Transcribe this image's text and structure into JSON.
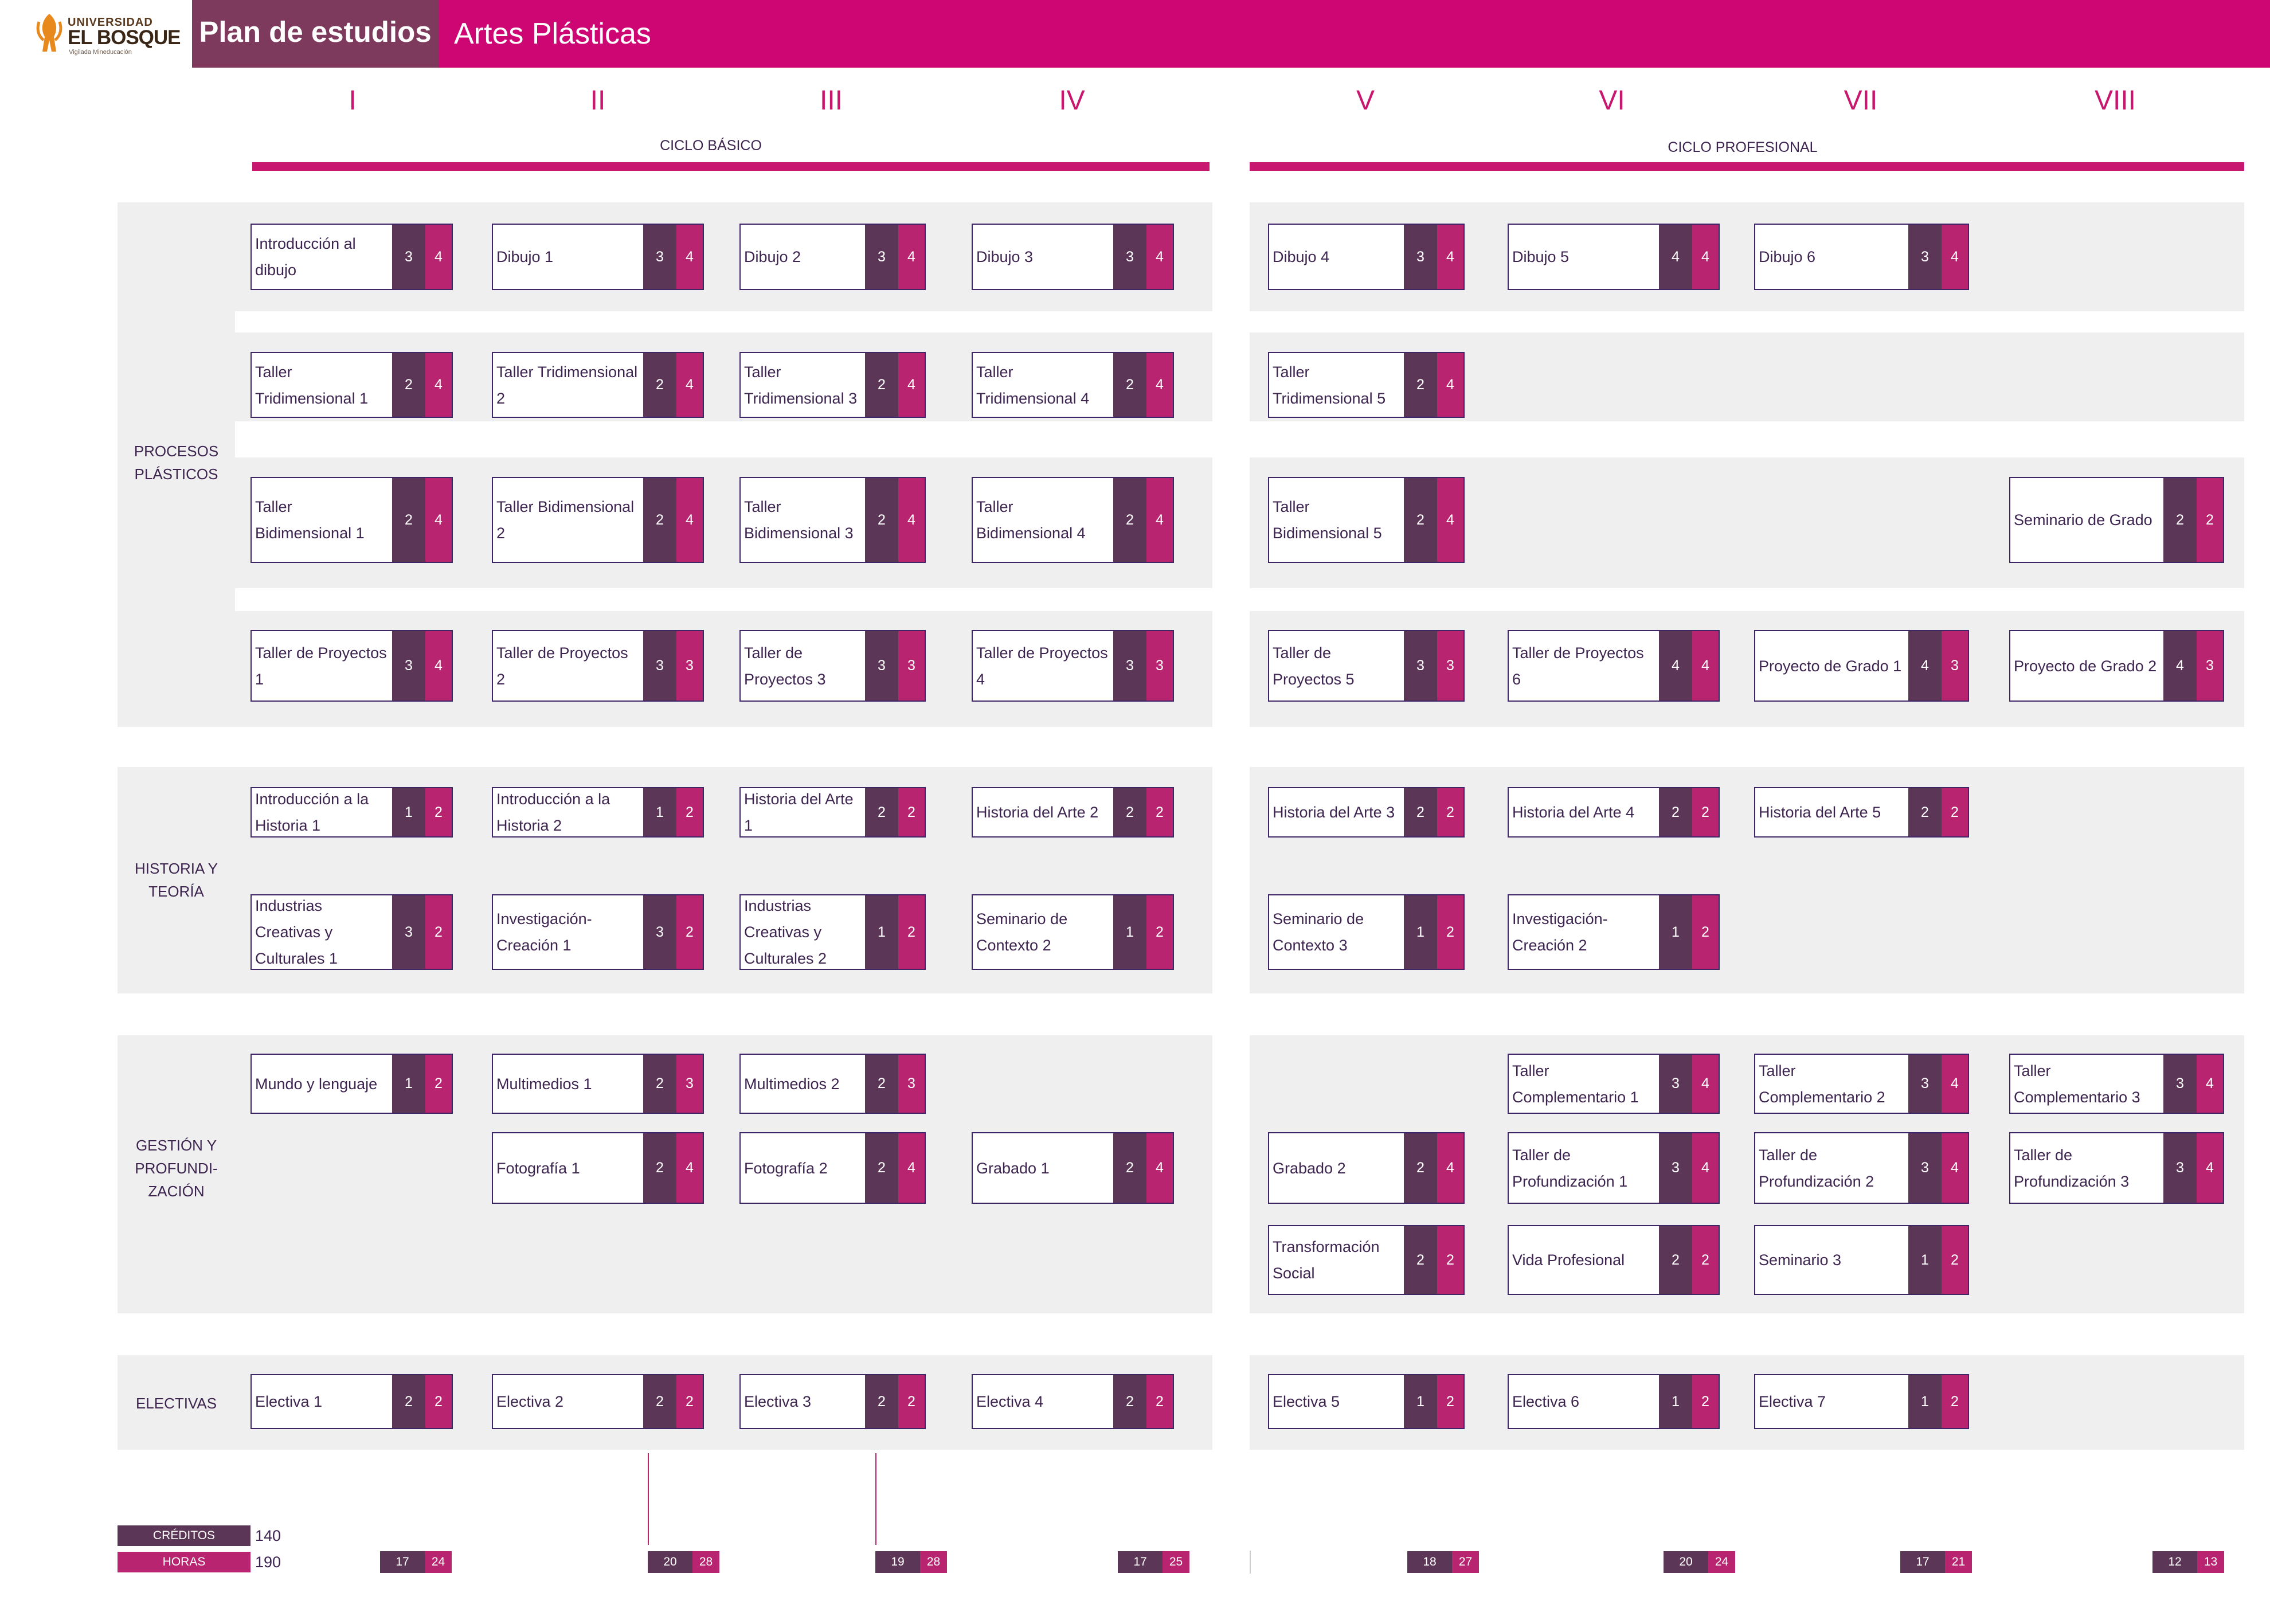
{
  "header": {
    "logo_univ": "UNIVERSIDAD",
    "logo_name": "EL BOSQUE",
    "logo_motto": "Vigilada Mineducación",
    "title": "Plan de estudios",
    "subtitle": "Artes Plásticas"
  },
  "semesters": [
    "I",
    "II",
    "III",
    "IV",
    "V",
    "VI",
    "VII",
    "VIII"
  ],
  "cycles": {
    "basic": "CICLO BÁSICO",
    "professional": "CICLO PROFESIONAL"
  },
  "areas": {
    "procesos": "PROCESOS PLÁSTICOS",
    "historia": "HISTORIA Y TEORÍA",
    "gestion": "GESTIÓN Y PROFUNDI-ZACIÓN",
    "electivas": "ELECTIVAS"
  },
  "courses": [
    {
      "name": "Introducción al dibujo",
      "credits": "3",
      "hours": "4"
    },
    {
      "name": "Dibujo 1",
      "credits": "3",
      "hours": "4"
    },
    {
      "name": "Dibujo 2",
      "credits": "3",
      "hours": "4"
    },
    {
      "name": "Dibujo 3",
      "credits": "3",
      "hours": "4"
    },
    {
      "name": "Dibujo 4",
      "credits": "3",
      "hours": "4"
    },
    {
      "name": "Dibujo 5",
      "credits": "4",
      "hours": "4"
    },
    {
      "name": "Dibujo 6",
      "credits": "3",
      "hours": "4"
    },
    {
      "name": "Taller Tridimensional 1",
      "credits": "2",
      "hours": "4"
    },
    {
      "name": "Taller Tridimensional 2",
      "credits": "2",
      "hours": "4"
    },
    {
      "name": "Taller Tridimensional 3",
      "credits": "2",
      "hours": "4"
    },
    {
      "name": "Taller Tridimensional 4",
      "credits": "2",
      "hours": "4"
    },
    {
      "name": "Taller Tridimensional 5",
      "credits": "2",
      "hours": "4"
    },
    {
      "name": "Taller Bidimensional 1",
      "credits": "2",
      "hours": "4"
    },
    {
      "name": "Taller Bidimensional 2",
      "credits": "2",
      "hours": "4"
    },
    {
      "name": "Taller Bidimensional 3",
      "credits": "2",
      "hours": "4"
    },
    {
      "name": "Taller Bidimensional 4",
      "credits": "2",
      "hours": "4"
    },
    {
      "name": "Taller Bidimensional 5",
      "credits": "2",
      "hours": "4"
    },
    {
      "name": "Seminario de Grado",
      "credits": "2",
      "hours": "2"
    },
    {
      "name": "Taller de Proyectos 1",
      "credits": "3",
      "hours": "4"
    },
    {
      "name": "Taller de Proyectos 2",
      "credits": "3",
      "hours": "3"
    },
    {
      "name": "Taller de Proyectos 3",
      "credits": "3",
      "hours": "3"
    },
    {
      "name": "Taller de Proyectos 4",
      "credits": "3",
      "hours": "3"
    },
    {
      "name": "Taller de Proyectos 5",
      "credits": "3",
      "hours": "3"
    },
    {
      "name": "Taller de Proyectos 6",
      "credits": "4",
      "hours": "4"
    },
    {
      "name": "Proyecto de Grado 1",
      "credits": "4",
      "hours": "3"
    },
    {
      "name": "Proyecto de Grado 2",
      "credits": "4",
      "hours": "3"
    },
    {
      "name": "Introducción a la Historia 1",
      "credits": "1",
      "hours": "2"
    },
    {
      "name": "Introducción a la Historia 2",
      "credits": "1",
      "hours": "2"
    },
    {
      "name": "Historia del Arte 1",
      "credits": "2",
      "hours": "2"
    },
    {
      "name": "Historia del Arte 2",
      "credits": "2",
      "hours": "2"
    },
    {
      "name": "Historia del Arte 3",
      "credits": "2",
      "hours": "2"
    },
    {
      "name": "Historia del Arte 4",
      "credits": "2",
      "hours": "2"
    },
    {
      "name": "Historia del Arte 5",
      "credits": "2",
      "hours": "2"
    },
    {
      "name": "Industrias Creativas y Culturales 1",
      "credits": "3",
      "hours": "2"
    },
    {
      "name": "Investigación-Creación 1",
      "credits": "3",
      "hours": "2"
    },
    {
      "name": "Industrias Creativas y Culturales 2",
      "credits": "1",
      "hours": "2"
    },
    {
      "name": "Seminario de Contexto 2",
      "credits": "1",
      "hours": "2"
    },
    {
      "name": "Seminario de Contexto 3",
      "credits": "1",
      "hours": "2"
    },
    {
      "name": "Investigación-Creación 2",
      "credits": "1",
      "hours": "2"
    },
    {
      "name": "Mundo y lenguaje",
      "credits": "1",
      "hours": "2"
    },
    {
      "name": "Multimedios 1",
      "credits": "2",
      "hours": "3"
    },
    {
      "name": "Multimedios 2",
      "credits": "2",
      "hours": "3"
    },
    {
      "name": "Taller Complementario 1",
      "credits": "3",
      "hours": "4"
    },
    {
      "name": "Taller Complementario 2",
      "credits": "3",
      "hours": "4"
    },
    {
      "name": "Taller Complementario 3",
      "credits": "3",
      "hours": "4"
    },
    {
      "name": "Fotografía 1",
      "credits": "2",
      "hours": "4"
    },
    {
      "name": "Fotografía 2",
      "credits": "2",
      "hours": "4"
    },
    {
      "name": "Grabado 1",
      "credits": "2",
      "hours": "4"
    },
    {
      "name": "Grabado 2",
      "credits": "2",
      "hours": "4"
    },
    {
      "name": "Taller de Profundización 1",
      "credits": "3",
      "hours": "4"
    },
    {
      "name": "Taller de Profundización 2",
      "credits": "3",
      "hours": "4"
    },
    {
      "name": "Taller de Profundización 3",
      "credits": "3",
      "hours": "4"
    },
    {
      "name": "Transformación Social",
      "credits": "2",
      "hours": "2"
    },
    {
      "name": "Vida Profesional",
      "credits": "2",
      "hours": "2"
    },
    {
      "name": "Seminario 3",
      "credits": "1",
      "hours": "2"
    },
    {
      "name": "Electiva 1",
      "credits": "2",
      "hours": "2"
    },
    {
      "name": "Electiva 2",
      "credits": "2",
      "hours": "2"
    },
    {
      "name": "Electiva 3",
      "credits": "2",
      "hours": "2"
    },
    {
      "name": "Electiva 4",
      "credits": "2",
      "hours": "2"
    },
    {
      "name": "Electiva 5",
      "credits": "1",
      "hours": "2"
    },
    {
      "name": "Electiva 6",
      "credits": "1",
      "hours": "2"
    },
    {
      "name": "Electiva 7",
      "credits": "1",
      "hours": "2"
    }
  ],
  "footer": {
    "credits_label": "CRÉDITOS",
    "hours_label": "HORAS",
    "credits_total": "140",
    "hours_total": "190",
    "semester_totals": [
      {
        "credits": "17",
        "hours": "24"
      },
      {
        "credits": "20",
        "hours": "28"
      },
      {
        "credits": "19",
        "hours": "28"
      },
      {
        "credits": "17",
        "hours": "25"
      },
      {
        "credits": "18",
        "hours": "27"
      },
      {
        "credits": "20",
        "hours": "24"
      },
      {
        "credits": "17",
        "hours": "21"
      },
      {
        "credits": "12",
        "hours": "13"
      }
    ]
  },
  "colors": {
    "magenta": "#cd0673",
    "plum": "#7d3a5d",
    "credit": "#5c3656",
    "hours": "#b8246f",
    "band": "#efefef",
    "border": "#3d2566"
  }
}
